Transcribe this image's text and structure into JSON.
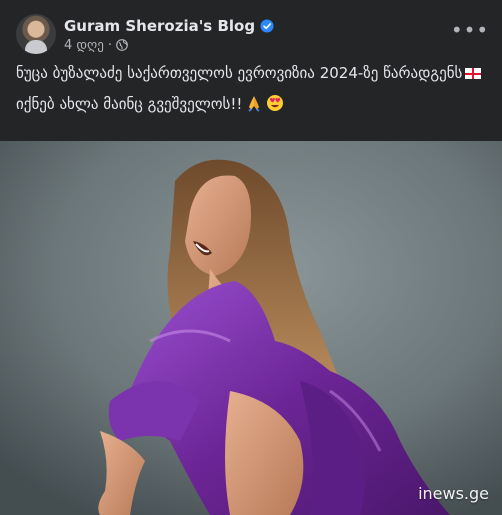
{
  "post": {
    "author": "Guram Sherozia's Blog",
    "timestamp": "4 დღე",
    "separator": "·",
    "privacy_icon": "globe-icon",
    "verified_icon": "verified-badge-icon",
    "more_icon": "more-options-icon",
    "more_label": "•••",
    "line1": "ნუცა ბუზალაძე საქართველოს ევროვიზია 2024-ზე წარადგენს",
    "line2": "იქნებ ახლა მაინც გვეშველოს!!",
    "emojis": [
      "flag-georgia-icon",
      "folded-hands-icon",
      "heart-eyes-icon"
    ]
  },
  "photo": {
    "subject": "photo-woman-purple-coat",
    "watermark": "inews.ge"
  },
  "colors": {
    "background": "#242526",
    "text_primary": "#e4e6eb",
    "text_secondary": "#b0b3b8",
    "verified": "#2d88ff",
    "coat": "#7a2fa8"
  }
}
